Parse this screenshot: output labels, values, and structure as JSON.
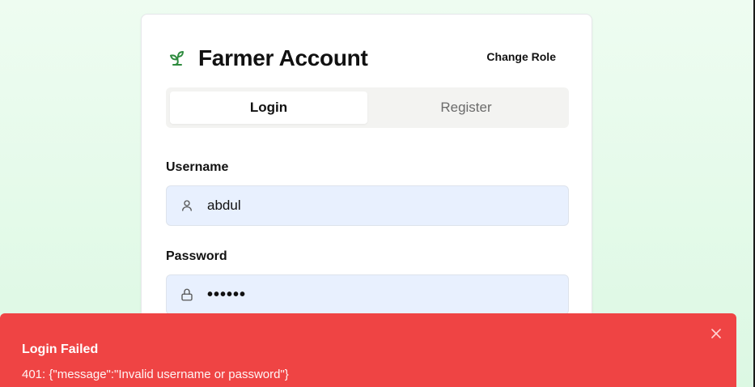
{
  "app": {
    "title": "Farmer Account",
    "change_role_label": "Change Role"
  },
  "tabs": [
    {
      "label": "Login",
      "active": true
    },
    {
      "label": "Register",
      "active": false
    }
  ],
  "form": {
    "username": {
      "label": "Username",
      "value": "abdul",
      "icon": "user-icon"
    },
    "password": {
      "label": "Password",
      "value": "••••••",
      "icon": "lock-icon"
    }
  },
  "toast": {
    "title": "Login Failed",
    "description": "401: {\"message\":\"Invalid username or password\"}",
    "color": "#ef4444"
  },
  "colors": {
    "accent_green": "#2e8b3e",
    "background": "#e3f9e8",
    "input_bg": "#e8f0fe",
    "toast_bg": "#ef4444"
  },
  "icons": {
    "brand": "sprout-icon",
    "toast_close": "close-icon"
  }
}
